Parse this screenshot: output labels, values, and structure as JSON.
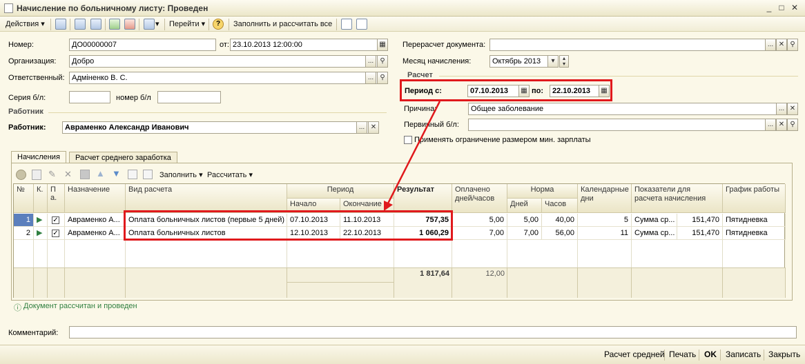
{
  "window": {
    "title": "Начисление по больничному листу: Проведен"
  },
  "toolbar": {
    "actions": "Действия",
    "goto": "Перейти",
    "fill_calc": "Заполнить и рассчитать все",
    "help": "?"
  },
  "form": {
    "number_label": "Номер:",
    "number": "ДО00000007",
    "from_label": "от:",
    "date": "23.10.2013 12:00:00",
    "org_label": "Организация:",
    "org": "Добро",
    "resp_label": "Ответственный:",
    "resp": "Адміненко В. С.",
    "series_label": "Серия б/л:",
    "series": "",
    "num_bl_label": "номер б/л",
    "num_bl": "",
    "worker_section": "Работник",
    "worker_label": "Работник:",
    "worker": "Авраменко Александр Иванович",
    "recalc_label": "Перерасчет документа:",
    "recalc": "",
    "month_label": "Месяц начисления:",
    "month": "Октябрь 2013",
    "calc_section": "Расчет",
    "period_label": "Период с:",
    "period_from": "07.10.2013",
    "period_to_label": "по:",
    "period_to": "22.10.2013",
    "reason_label": "Причина:",
    "reason": "Общее заболевание",
    "primary_label": "Первичный б/л:",
    "primary": "",
    "limit_label": "Применять ограничение размером мин. зарплаты",
    "comment_label": "Комментарий:",
    "comment": ""
  },
  "tabs": [
    "Начисления",
    "Расчет среднего заработка"
  ],
  "grid_toolbar": {
    "fill": "Заполнить",
    "calc": "Рассчитать"
  },
  "grid": {
    "headers": {
      "n": "№",
      "k": "К.",
      "p": "П а.",
      "nazn": "Назначение",
      "vid": "Вид расчета",
      "period": "Период",
      "start": "Начало",
      "end": "Окончание",
      "result": "Результат",
      "paid": "Оплачено дней/часов",
      "norm": "Норма",
      "days": "Дней",
      "hours": "Часов",
      "cal": "Календарные дни",
      "pok": "Показатели для расчета начисления",
      "graph": "График работы"
    },
    "rows": [
      {
        "n": "1",
        "nazn": "Авраменко А...",
        "vid": "Оплата больничных листов (первые 5 дней)",
        "start": "07.10.2013",
        "end": "11.10.2013",
        "result": "757,35",
        "paid": "5,00",
        "days": "5,00",
        "hours": "40,00",
        "cal": "5",
        "pok": "Сумма ср...",
        "pokv": "151,470",
        "graph": "Пятидневка"
      },
      {
        "n": "2",
        "nazn": "Авраменко А...",
        "vid": "Оплата больничных листов",
        "start": "12.10.2013",
        "end": "22.10.2013",
        "result": "1 060,29",
        "paid": "7,00",
        "days": "7,00",
        "hours": "56,00",
        "cal": "11",
        "pok": "Сумма ср...",
        "pokv": "151,470",
        "graph": "Пятидневка"
      }
    ],
    "total_result": "1 817,64",
    "total_paid": "12,00"
  },
  "status_msg": "Документ рассчитан и проведен",
  "bottom": {
    "avg": "Расчет средней",
    "print": "Печать",
    "ok": "OK",
    "save": "Записать",
    "close": "Закрыть"
  }
}
